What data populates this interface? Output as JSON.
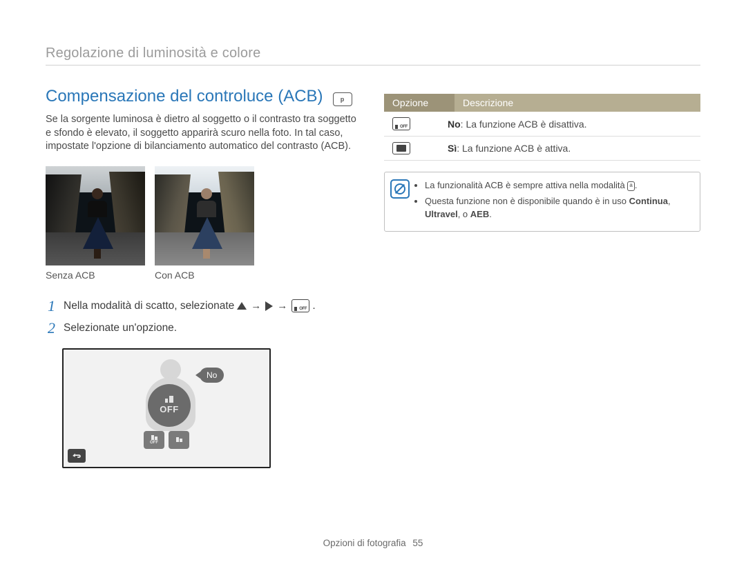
{
  "breadcrumb": "Regolazione di luminosità e colore",
  "section": {
    "title": "Compensazione del controluce (ACB)",
    "mode_icon": "p",
    "body": "Se la sorgente luminosa è dietro al soggetto o il contrasto tra soggetto e sfondo è elevato, il soggetto apparirà scuro nella foto. In tal caso, impostate l'opzione di bilanciamento automatico del contrasto (ACB)."
  },
  "photos": {
    "without": "Senza ACB",
    "with": "Con ACB"
  },
  "steps": [
    {
      "num": "1",
      "prefix": "Nella modalità di scatto, selezionate",
      "suffix": "."
    },
    {
      "num": "2",
      "text": "Selezionate un'opzione."
    }
  ],
  "lcd": {
    "tooltip": "No",
    "big_label": "OFF",
    "thumb_off": "OFF"
  },
  "options_table": {
    "header_option": "Opzione",
    "header_desc": "Descrizione",
    "rows": [
      {
        "bold": "No",
        "rest": ": La funzione ACB è disattiva."
      },
      {
        "bold": "Sì",
        "rest": ": La funzione ACB è attiva."
      }
    ]
  },
  "note": {
    "line1_prefix": "La funzionalità ACB è sempre attiva nella modalità ",
    "line1_mode": "a",
    "line1_suffix": ".",
    "line2_prefix": "Questa funzione non è disponibile quando è in uso ",
    "line2_b1": "Continua",
    "line2_mid": ", ",
    "line2_b2": "Ultravel",
    "line2_mid2": ", o ",
    "line2_b3": "AEB",
    "line2_suffix": "."
  },
  "footer": {
    "section": "Opzioni di fotografia",
    "page": "55"
  }
}
